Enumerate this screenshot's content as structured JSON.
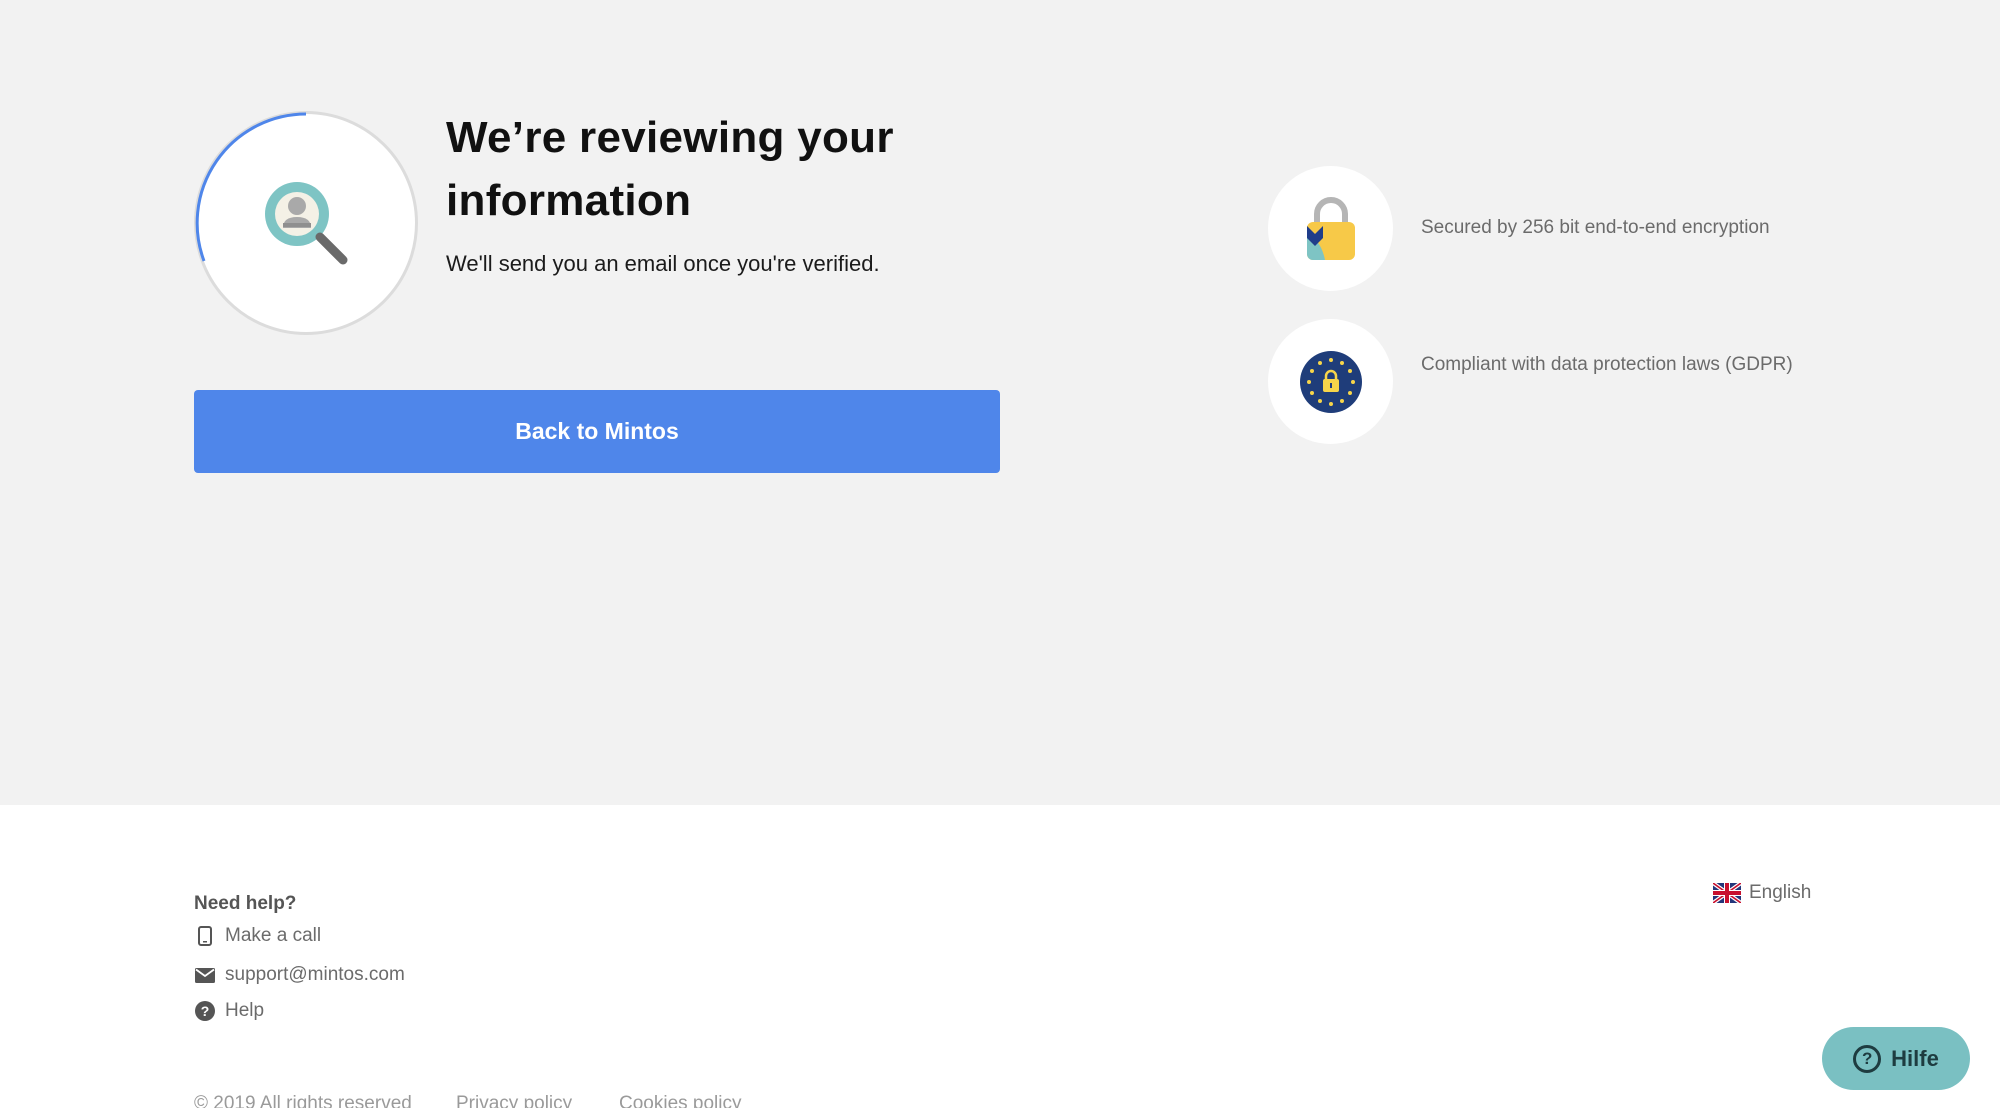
{
  "main": {
    "title": "We’re reviewing your information",
    "subtitle": "We'll send you an email once you're verified.",
    "back_button_label": "Back to Mintos",
    "accent_color": "#4f86ea",
    "status_icon": "magnifier-user-icon"
  },
  "features": [
    {
      "icon": "padlock-icon",
      "text": "Secured by 256 bit end-to-end encryption"
    },
    {
      "icon": "eu-gdpr-lock-icon",
      "text": "Compliant with data protection laws (GDPR)"
    }
  ],
  "footer": {
    "need_help": "Need help?",
    "links": [
      {
        "icon": "phone-icon",
        "label": "Make a call"
      },
      {
        "icon": "mail-icon",
        "label": "support@mintos.com"
      },
      {
        "icon": "question-circle-icon",
        "label": "Help"
      }
    ],
    "language": {
      "icon": "uk-flag-icon",
      "label": "English"
    },
    "legal": {
      "copyright": "© 2019 All rights reserved",
      "privacy": "Privacy policy",
      "cookies": "Cookies policy"
    }
  },
  "help_widget": {
    "label": "Hilfe",
    "icon": "question-icon",
    "color": "#7ac0c2"
  }
}
